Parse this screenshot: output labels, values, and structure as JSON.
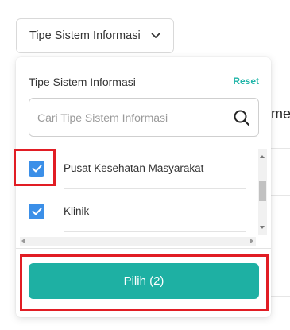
{
  "trigger": {
    "label": "Tipe Sistem Informasi",
    "icon": "chevron-down-icon"
  },
  "panel": {
    "title": "Tipe Sistem Informasi",
    "reset_label": "Reset",
    "search": {
      "placeholder": "Cari Tipe Sistem Informasi",
      "value": "",
      "icon": "search-icon"
    },
    "items": [
      {
        "label": "Pusat Kesehatan Masyarakat",
        "checked": true
      },
      {
        "label": "Klinik",
        "checked": true
      }
    ],
    "submit_label": "Pilih (2)"
  },
  "background": {
    "partial_text": "me"
  },
  "colors": {
    "accent": "#1eb0a3",
    "checkbox": "#3b8fe8",
    "highlight": "#e11d24"
  }
}
